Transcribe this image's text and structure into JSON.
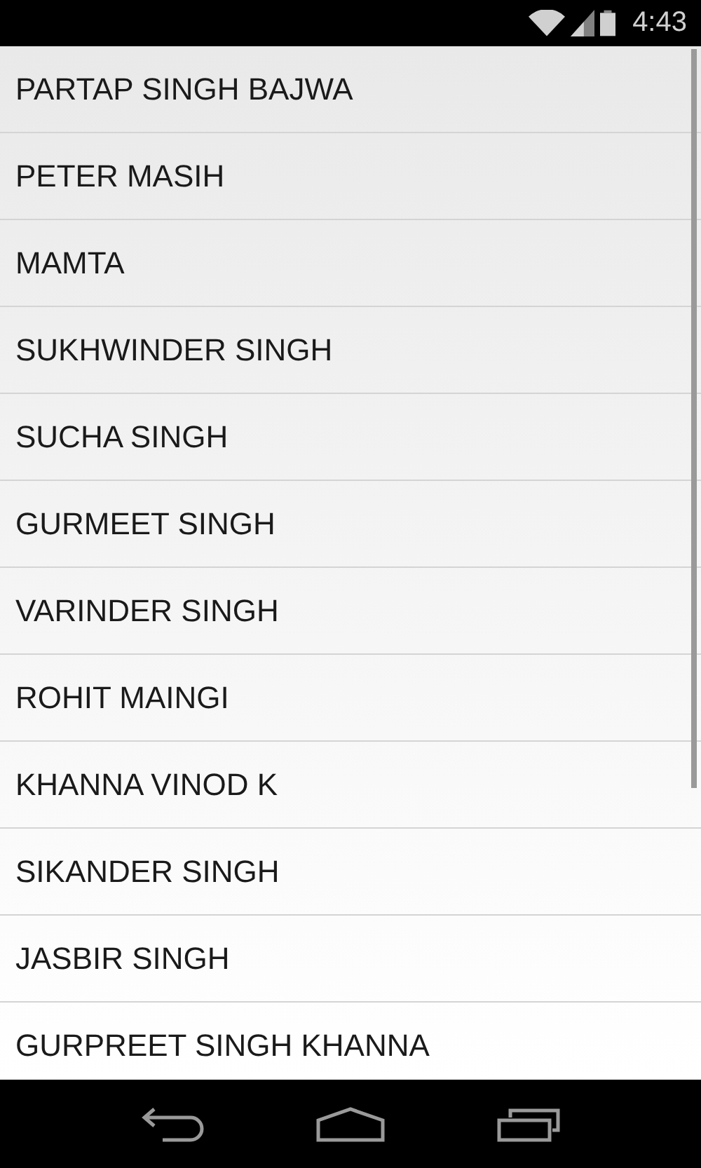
{
  "status_bar": {
    "time": "4:43"
  },
  "list": {
    "items": [
      {
        "name": "PARTAP SINGH BAJWA"
      },
      {
        "name": "PETER MASIH"
      },
      {
        "name": "MAMTA"
      },
      {
        "name": "SUKHWINDER SINGH"
      },
      {
        "name": "SUCHA SINGH"
      },
      {
        "name": "GURMEET SINGH"
      },
      {
        "name": "VARINDER SINGH"
      },
      {
        "name": "ROHIT MAINGI"
      },
      {
        "name": "KHANNA VINOD K"
      },
      {
        "name": "SIKANDER SINGH"
      },
      {
        "name": "JASBIR SINGH"
      },
      {
        "name": "GURPREET SINGH KHANNA"
      }
    ]
  }
}
